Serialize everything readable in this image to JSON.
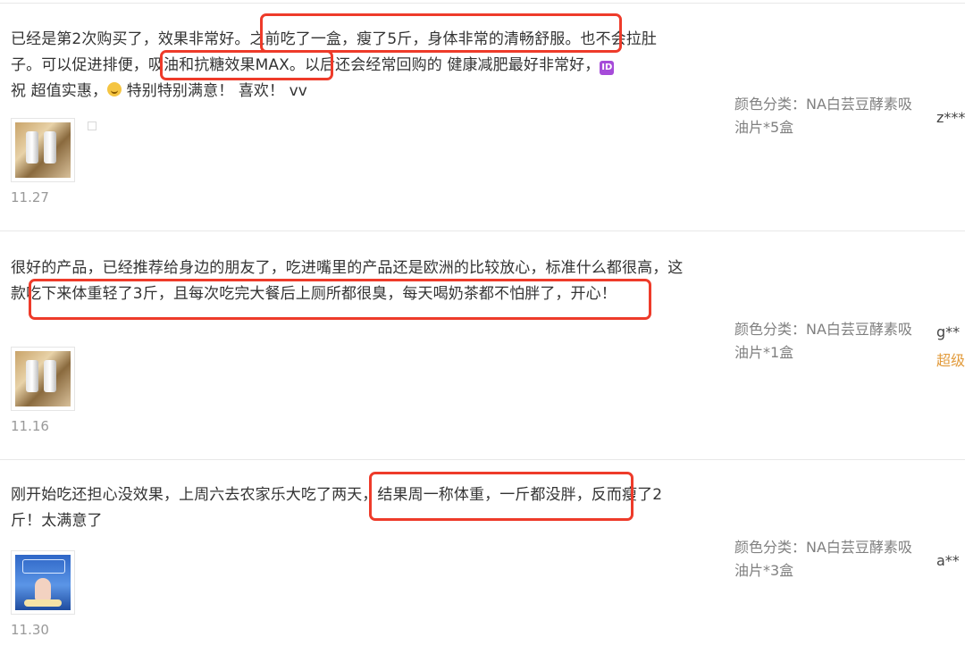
{
  "reviews": [
    {
      "text_parts": [
        "已经是第2次购买了，效果非常好。之前吃了一盒，瘦了5斤，身体非常的清畅舒服。也不会拉肚子。可以促进排便，吸油和抗糖效果MAX。以后还会经常回购的 健康减肥最好非常好，",
        "祝 超值实惠，",
        " 特别特别满意！ 喜欢！ vv"
      ],
      "date": "11.27",
      "sku": "颜色分类：NA白芸豆酵素吸油片*5盒",
      "user": "z***"
    },
    {
      "text": "很好的产品，已经推荐给身边的朋友了，吃进嘴里的产品还是欧洲的比较放心，标准什么都很高，这款吃下来体重轻了3斤，且每次吃完大餐后上厕所都很臭，每天喝奶茶都不怕胖了，开心！",
      "date": "11.16",
      "sku": "颜色分类：NA白芸豆酵素吸油片*1盒",
      "user": "g**",
      "member_badge": "超级"
    },
    {
      "text": "刚开始吃还担心没效果，上周六去农家乐大吃了两天，结果周一称体重，一斤都没胖，反而瘦了2斤！太满意了",
      "date": "11.30",
      "sku": "颜色分类：NA白芸豆酵素吸油片*3盒",
      "user": "a**"
    }
  ],
  "icons": {
    "id_badge": "ID",
    "smile": "smile-emoji-icon"
  },
  "colors": {
    "highlight": "#ee3b2a",
    "member": "#e29b3c",
    "meta_text": "#999999"
  }
}
